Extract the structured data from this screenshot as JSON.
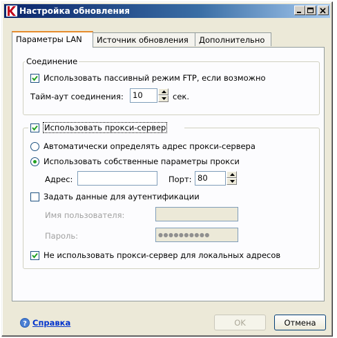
{
  "window": {
    "title": "Настройка обновления"
  },
  "tabs": [
    {
      "label": "Параметры LAN",
      "active": true
    },
    {
      "label": "Источник обновления",
      "active": false
    },
    {
      "label": "Дополнительно",
      "active": false
    }
  ],
  "connection": {
    "group_title": "Соединение",
    "passive_ftp_label": "Использовать пассивный режим FTP, если возможно",
    "passive_ftp_checked": true,
    "timeout_label": "Тайм-аут соединения:",
    "timeout_value": "10",
    "timeout_unit": "сек."
  },
  "proxy": {
    "use_proxy_label": "Использовать прокси-сервер",
    "use_proxy_checked": true,
    "auto_detect_label": "Автоматически определять адрес прокси-сервера",
    "auto_detect_selected": false,
    "custom_label": "Использовать собственные параметры прокси",
    "custom_selected": true,
    "address_label": "Адрес:",
    "address_value": "",
    "port_label": "Порт:",
    "port_value": "80",
    "auth_label": "Задать данные для аутентификации",
    "auth_checked": false,
    "username_label": "Имя пользователя:",
    "username_value": "",
    "password_label": "Пароль:",
    "password_value": "●●●●●●●●●●",
    "bypass_local_label": "Не использовать прокси-сервер для локальных адресов",
    "bypass_local_checked": true
  },
  "footer": {
    "help_label": "Справка",
    "ok_label": "OK",
    "cancel_label": "Отмена"
  }
}
